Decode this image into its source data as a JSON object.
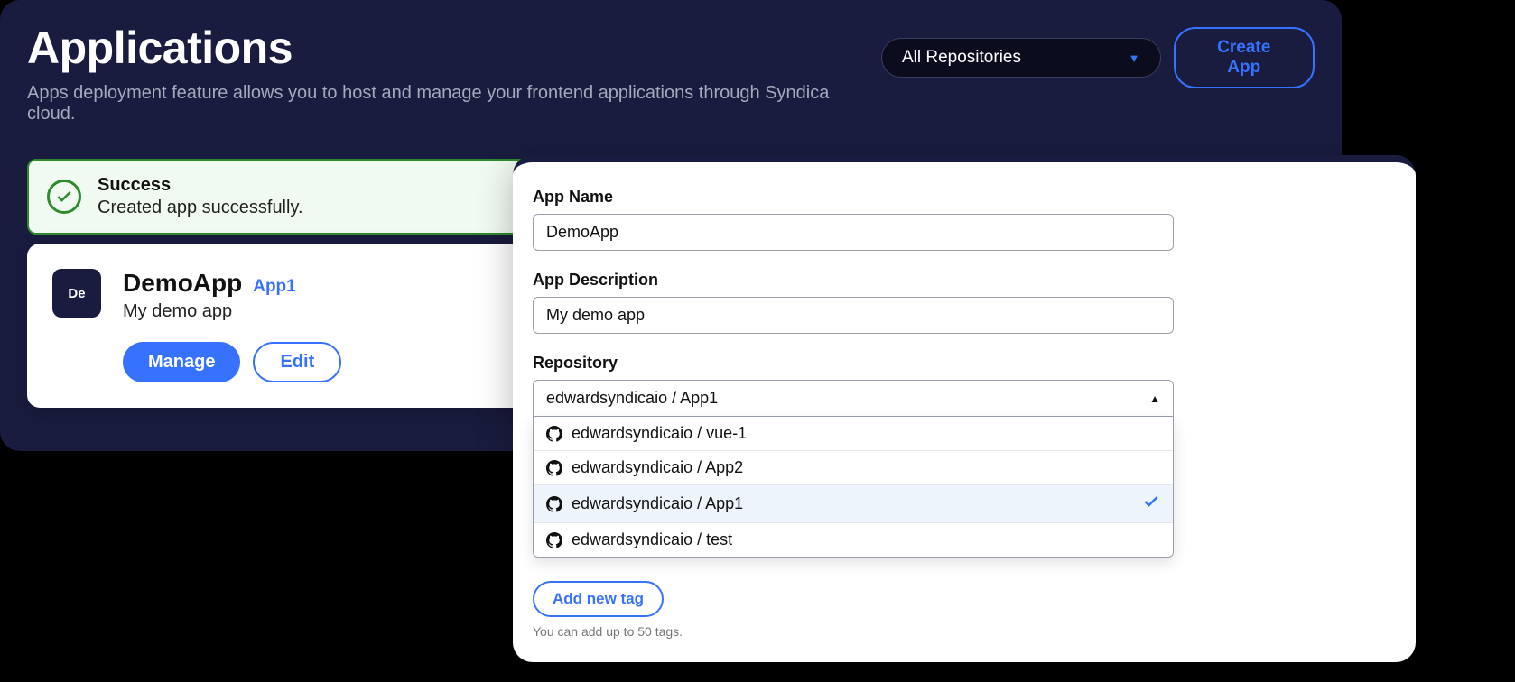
{
  "header": {
    "title": "Applications",
    "subtitle": "Apps deployment feature allows you to host and manage your frontend applications through Syndica cloud.",
    "repo_filter": "All Repositories",
    "create_label": "Create App"
  },
  "alert": {
    "title": "Success",
    "message": "Created app successfully."
  },
  "app_card": {
    "avatar": "De",
    "name": "DemoApp",
    "repo_link": "App1",
    "description": "My demo app",
    "manage_label": "Manage",
    "edit_label": "Edit"
  },
  "modal": {
    "fields": {
      "name_label": "App Name",
      "name_value": "DemoApp",
      "desc_label": "App Description",
      "desc_value": "My demo app",
      "repo_label": "Repository",
      "repo_selected": "edwardsyndicaio / App1"
    },
    "repo_options": [
      {
        "label": "edwardsyndicaio / vue-1",
        "selected": false
      },
      {
        "label": "edwardsyndicaio / App2",
        "selected": false
      },
      {
        "label": "edwardsyndicaio / App1",
        "selected": true
      },
      {
        "label": "edwardsyndicaio / test",
        "selected": false
      }
    ],
    "add_tag_label": "Add new tag",
    "tag_hint": "You can add up to 50 tags."
  }
}
